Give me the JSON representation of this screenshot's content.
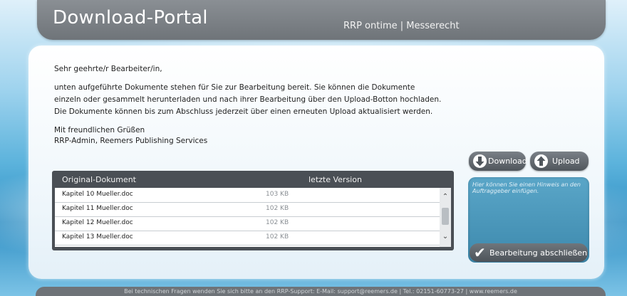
{
  "header": {
    "title": "Download-Portal",
    "subtitle": "RRP ontime | Messerecht"
  },
  "letter": {
    "greeting": "Sehr geehrte/r Bearbeiter/in,",
    "intro": [
      "unten aufgeführte Dokumente stehen für Sie zur Bearbeitung bereit. Sie können die Dokumente",
      "einzeln oder gesammelt herunterladen und nach ihrer Bearbeitung über den Upload-Botton hochladen.",
      "Die Dokumente können bis zum Abschluss jederzeit über einen erneuten Upload aktualisiert werden."
    ],
    "closing": [
      "Mit freundlichen Grüßen",
      "RRP-Admin, Reemers Publishing Services"
    ]
  },
  "buttons": {
    "download": "Download",
    "upload": "Upload",
    "finish": "Bearbeitung abschließen"
  },
  "icons": {
    "download": "arrow-down-icon",
    "upload": "arrow-up-icon",
    "finish": "checkmark-icon"
  },
  "table": {
    "headers": [
      "Original-Dokument",
      "letzte Version"
    ],
    "rows": [
      {
        "name": "Kapitel 10 Mueller.doc",
        "size": "103 KB"
      },
      {
        "name": "Kapitel 11 Mueller.doc",
        "size": "102 KB"
      },
      {
        "name": "Kapitel 12 Mueller.doc",
        "size": "102 KB"
      },
      {
        "name": "Kapitel 13 Mueller.doc",
        "size": "102 KB"
      }
    ]
  },
  "note": {
    "placeholder": "Hier können Sie einen Hinweis an den Auftraggeber einfügen."
  },
  "footer": {
    "text": "Bei technischen Fragen wenden Sie sich bitte an den RRP-Support: E-Mail: support@reemers.de | Tel.: 02151-60773-27 | www.reemers.de"
  },
  "colors": {
    "header_bg": "#6f7479",
    "button_bg": "#50565c",
    "note_bg": "#3d89ad"
  }
}
